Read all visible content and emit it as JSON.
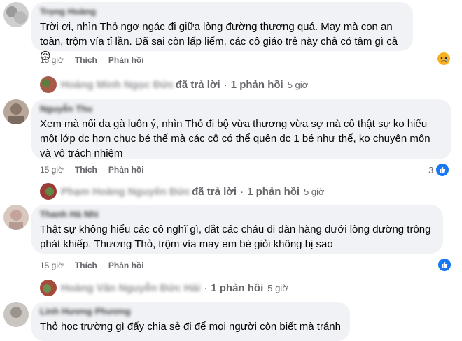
{
  "comments": [
    {
      "author": "Trọng Hoàng",
      "text": "Trời ơi, nhìn Thỏ ngơ ngác đi giữa lòng đường thương quá. May mà con an toàn, trộm vía tỉ lần. Đã sai còn lấp liếm, các cô giáo trẻ này chả có tâm gì cả",
      "text_emoji": "😥",
      "time": "15 giờ",
      "like_label": "Thích",
      "reply_label": "Phản hồi",
      "reply_thread": {
        "replier": "Hoàng Minh Ngọc Đức",
        "replied_label": "đã trả lời",
        "count_label": "1 phản hồi",
        "time": "5 giờ"
      }
    },
    {
      "author": "Nguyễn Thu",
      "text": "Xem mà nổi da gà luôn ý, nhìn Thỏ đi bộ vừa thương vừa sợ mà cô thật sự ko hiểu một lớp dc hơn chục bé thế mà các cô có thể quên dc 1 bé như thế, ko chuyên môn và vô trách nhiệm",
      "time": "15 giờ",
      "like_label": "Thích",
      "reply_label": "Phản hồi",
      "reaction_count": "3",
      "reply_thread": {
        "replier": "Phạm Hoàng Nguyên Đức",
        "replied_label": "đã trả lời",
        "count_label": "1 phản hồi",
        "time": "5 giờ"
      }
    },
    {
      "author": "Thanh Hà Nhi",
      "text": "Thật sự không hiểu các cô nghĩ gì, dắt các cháu đi dàn hàng dưới lòng đường trông phát khiếp. Thương Thỏ, trộm vía may em bé giỏi không bị sao",
      "time": "15 giờ",
      "like_label": "Thích",
      "reply_label": "Phản hồi",
      "reply_thread": {
        "replier": "Hoàng Văn Nguyễn Đức Hải",
        "replied_label": "",
        "count_label": "1 phản hồi",
        "time": "5 giờ"
      }
    },
    {
      "author": "Linh Hương Phương",
      "text": "Thỏ học trường gì đấy chia sẻ đi để mọi người còn biết mà tránh"
    }
  ],
  "colors": {
    "bubble": "#f0f2f5",
    "meta": "#65676b",
    "like_blue": "#1877f2"
  }
}
